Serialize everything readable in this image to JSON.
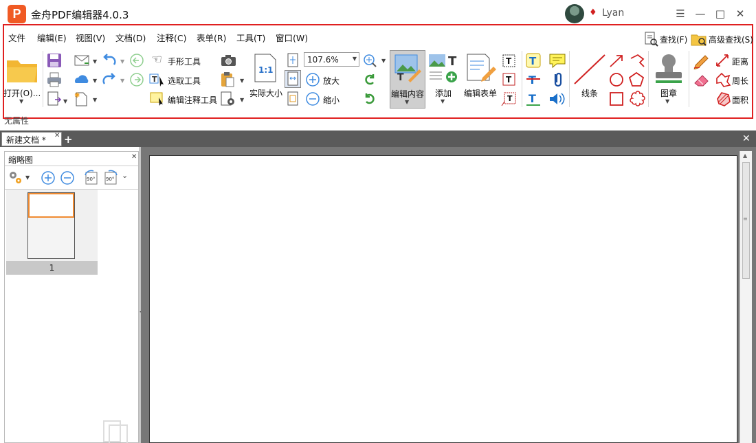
{
  "app": {
    "logo": "P",
    "title": "金舟PDF编辑器4.0.3",
    "user": "Lyan"
  },
  "menu": [
    "文件",
    "编辑(E)",
    "视图(V)",
    "文档(D)",
    "注释(C)",
    "表单(R)",
    "工具(T)",
    "窗口(W)"
  ],
  "search": {
    "find": "查找(F)",
    "advanced_find": "高级查找(S)"
  },
  "toolbar": {
    "open": "打开(O)...",
    "hand_tool": "手形工具",
    "select_tool": "选取工具",
    "edit_annotation_tool": "编辑注释工具",
    "actual_size": "实际大小",
    "actual_size_icon": "1:1",
    "zoom_value": "107.6%",
    "zoom_in": "放大",
    "zoom_out": "缩小",
    "edit_content": "编辑内容",
    "add": "添加",
    "edit_form": "编辑表单",
    "line": "线条",
    "stamp": "图章",
    "distance": "距离",
    "perimeter": "周长",
    "area": "面积"
  },
  "properties_label": "无属性",
  "tabs": [
    {
      "label": "新建文档 *"
    }
  ],
  "thumbnail_panel": {
    "title": "缩略图",
    "rotate_left": "90°",
    "rotate_right": "90°",
    "pages": [
      {
        "label": "1"
      }
    ]
  },
  "icons": [
    "menu-icon",
    "minimize-icon",
    "maximize-icon",
    "close-icon",
    "add-tab-icon",
    "folder-icon",
    "save-icon",
    "print-icon",
    "email-icon",
    "undo-icon",
    "redo-icon",
    "hand-icon",
    "camera-icon",
    "stamp-icon",
    "eraser-icon"
  ],
  "colors": {
    "accent": "#f05a24",
    "highlight": "#e02020",
    "tab_bar": "#5a5a5a",
    "canvas": "#777777"
  }
}
